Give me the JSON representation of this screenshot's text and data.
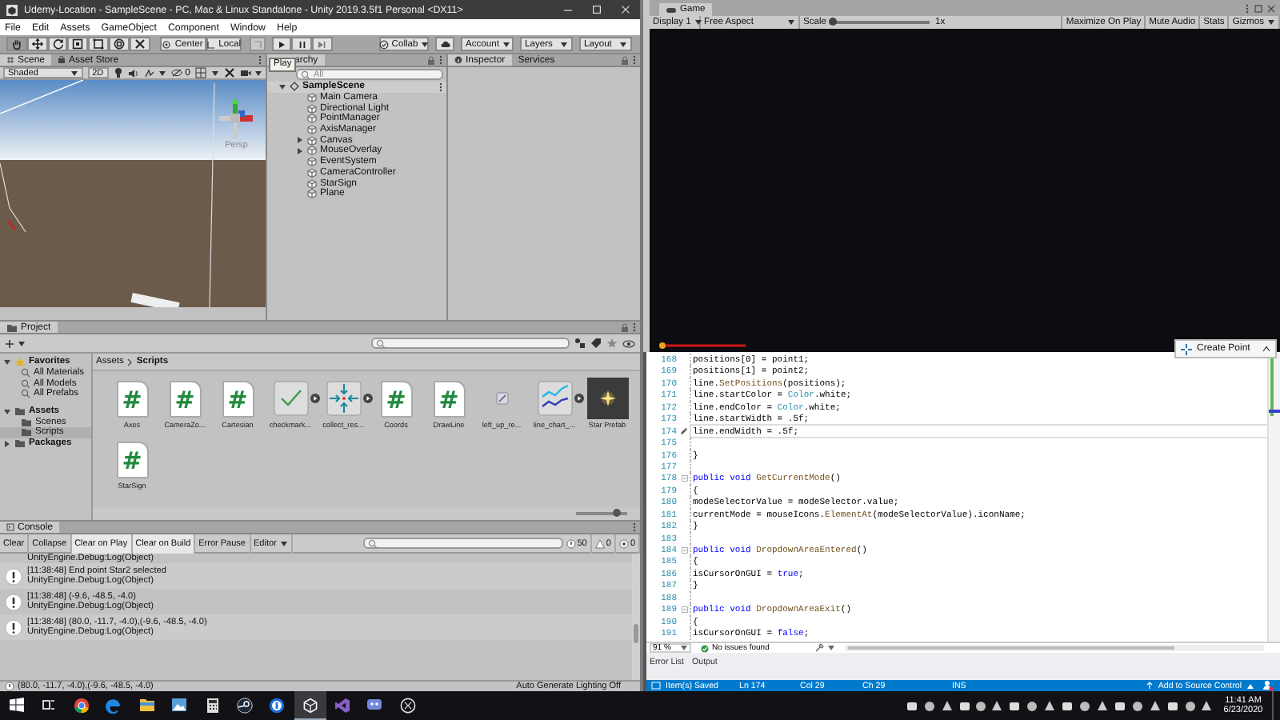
{
  "unity": {
    "title": "Udemy-Location - SampleScene - PC, Mac & Linux Standalone - Unity 2019.3.5f1 Personal <DX11>",
    "menu": [
      "File",
      "Edit",
      "Assets",
      "GameObject",
      "Component",
      "Window",
      "Help"
    ],
    "toolbar": {
      "tools": [
        {
          "kind": "hand",
          "selected": true
        },
        {
          "kind": "move",
          "selected": false
        },
        {
          "kind": "rotate",
          "selected": false
        },
        {
          "kind": "scale",
          "selected": false
        },
        {
          "kind": "rect",
          "selected": false
        },
        {
          "kind": "transform",
          "selected": false
        },
        {
          "kind": "custom",
          "selected": false
        }
      ],
      "pivot_buttons": [
        "Center",
        "Local"
      ],
      "collab": "Collab",
      "dropdowns": [
        "Account",
        "Layers",
        "Layout"
      ],
      "tooltip": "Play"
    },
    "scene": {
      "tabs": [
        {
          "label": "Scene",
          "selected": true
        },
        {
          "label": "Asset Store",
          "selected": false
        }
      ],
      "shading": "Shaded",
      "mode_2d": "2D",
      "hidden_count": "0",
      "view_label": "Persp"
    },
    "hierarchy": {
      "tab": "archy",
      "search_placeholder": "All",
      "scene": "SampleScene",
      "items": [
        {
          "label": "Main Camera",
          "has_children": false
        },
        {
          "label": "Directional Light",
          "has_children": false
        },
        {
          "label": "PointManager",
          "has_children": false
        },
        {
          "label": "AxisManager",
          "has_children": false
        },
        {
          "label": "Canvas",
          "has_children": true
        },
        {
          "label": "MouseOverlay",
          "has_children": true
        },
        {
          "label": "EventSystem",
          "has_children": false
        },
        {
          "label": "CameraController",
          "has_children": false
        },
        {
          "label": "StarSign",
          "has_children": false
        },
        {
          "label": "Plane",
          "has_children": false
        }
      ]
    },
    "inspector": {
      "tabs": [
        {
          "label": "Inspector",
          "selected": true
        },
        {
          "label": "Services",
          "selected": false
        }
      ]
    },
    "project": {
      "tab": "Project",
      "tree": [
        {
          "label": "Favorites",
          "kind": "favorites",
          "expanded": true,
          "selected": false,
          "children": [
            {
              "label": "All Materials",
              "kind": "search",
              "selected": false
            },
            {
              "label": "All Models",
              "kind": "search",
              "selected": false
            },
            {
              "label": "All Prefabs",
              "kind": "search",
              "selected": false
            }
          ]
        },
        {
          "label": "Assets",
          "kind": "folder",
          "expanded": true,
          "selected": false,
          "children": [
            {
              "label": "Scenes",
              "kind": "folder",
              "selected": false
            },
            {
              "label": "Scripts",
              "kind": "folder",
              "selected": true
            }
          ]
        },
        {
          "label": "Packages",
          "kind": "folder",
          "expanded": false,
          "selected": false
        }
      ],
      "breadcrumb": [
        "Assets",
        "Scripts"
      ],
      "assets": [
        {
          "label": "Axes",
          "kind": "script",
          "glyph": "#",
          "expandable": false
        },
        {
          "label": "CameraZo...",
          "kind": "script",
          "glyph": "#",
          "expandable": false
        },
        {
          "label": "Cartesian",
          "kind": "script",
          "glyph": "#",
          "expandable": false
        },
        {
          "label": "checkmark...",
          "kind": "checkmark",
          "expandable": true
        },
        {
          "label": "collect_res...",
          "kind": "collect",
          "expandable": true
        },
        {
          "label": "Coords",
          "kind": "script",
          "glyph": "#",
          "expandable": false
        },
        {
          "label": "DrawLine",
          "kind": "script",
          "glyph": "#",
          "expandable": false
        },
        {
          "label": "left_up_re...",
          "kind": "link",
          "expandable": false
        },
        {
          "label": "line_chart_...",
          "kind": "line_chart",
          "expandable": true
        },
        {
          "label": "Star Prefab",
          "kind": "prefab",
          "expandable": false
        },
        {
          "label": "StarSign",
          "kind": "script",
          "glyph": "#",
          "expandable": false
        }
      ],
      "icon_size": {
        "level": 0.8
      }
    },
    "console": {
      "tab": "Console",
      "buttons": [
        {
          "label": "Clear",
          "on": false
        },
        {
          "label": "Collapse",
          "on": false
        },
        {
          "label": "Clear on Play",
          "on": true
        },
        {
          "label": "Clear on Build",
          "on": true
        },
        {
          "label": "Error Pause",
          "on": false
        }
      ],
      "editor_dropdown": "Editor",
      "counts": [
        {
          "kind": "log",
          "count": "50"
        },
        {
          "kind": "warning",
          "count": "0"
        },
        {
          "kind": "error",
          "count": "0"
        }
      ],
      "entries": [
        {
          "trace": "UnityEngine.Debug:Log(Object)"
        },
        {
          "message": "[11:38:48] End point Star2 selected",
          "trace": "UnityEngine.Debug:Log(Object)"
        },
        {
          "message": "[11:38:48] (-9.6, -48.5, -4.0)",
          "trace": "UnityEngine.Debug:Log(Object)"
        },
        {
          "message": "[11:38:48] (80.0, -11.7, -4.0),(-9.6, -48.5, -4.0)",
          "trace": "UnityEngine.Debug:Log(Object)"
        }
      ]
    },
    "status_bar": {
      "message": "(80.0, -11.7, -4.0),(-9.6, -48.5, -4.0)",
      "lighting": "Auto Generate Lighting Off"
    }
  },
  "game": {
    "tab": "Game",
    "display": "Display 1",
    "aspect": "Free Aspect",
    "scale_label": "Scale",
    "scale": {
      "level": 0
    },
    "scale_value": "1x",
    "buttons": [
      "Maximize On Play",
      "Mute Audio",
      "Stats",
      "Gizmos"
    ],
    "create_point": "Create Point"
  },
  "editor": {
    "lines": [
      {
        "number": "168",
        "current": false,
        "foldable": false,
        "segments": [
          {
            "text": "        positions[0] = point1;",
            "kind": "plain"
          }
        ]
      },
      {
        "number": "169",
        "current": false,
        "foldable": false,
        "segments": [
          {
            "text": "        positions[1] = point2;",
            "kind": "plain"
          }
        ]
      },
      {
        "number": "170",
        "current": false,
        "foldable": false,
        "segments": [
          {
            "text": "        line.",
            "kind": "plain"
          },
          {
            "text": "SetPositions",
            "kind": "method"
          },
          {
            "text": "(positions);",
            "kind": "plain"
          }
        ]
      },
      {
        "number": "171",
        "current": false,
        "foldable": false,
        "segments": [
          {
            "text": "        line.startColor = ",
            "kind": "plain"
          },
          {
            "text": "Color",
            "kind": "type"
          },
          {
            "text": ".white;",
            "kind": "plain"
          }
        ]
      },
      {
        "number": "172",
        "current": false,
        "foldable": false,
        "segments": [
          {
            "text": "        line.endColor = ",
            "kind": "plain"
          },
          {
            "text": "Color",
            "kind": "type"
          },
          {
            "text": ".white;",
            "kind": "plain"
          }
        ]
      },
      {
        "number": "173",
        "current": false,
        "foldable": false,
        "segments": [
          {
            "text": "        line.startWidth = .5f;",
            "kind": "plain"
          }
        ]
      },
      {
        "number": "174",
        "current": true,
        "foldable": false,
        "segments": [
          {
            "text": "        line.endWidth = .5f;",
            "kind": "plain"
          }
        ]
      },
      {
        "number": "175",
        "current": false,
        "foldable": false
      },
      {
        "number": "176",
        "current": false,
        "foldable": false,
        "segments": [
          {
            "text": "    }",
            "kind": "plain"
          }
        ]
      },
      {
        "number": "177",
        "current": false,
        "foldable": false
      },
      {
        "number": "178",
        "current": false,
        "foldable": true,
        "segments": [
          {
            "text": "    public void ",
            "kind": "keyword"
          },
          {
            "text": "GetCurrentMode",
            "kind": "method"
          },
          {
            "text": "()",
            "kind": "plain"
          }
        ]
      },
      {
        "number": "179",
        "current": false,
        "foldable": false,
        "segments": [
          {
            "text": "    {",
            "kind": "plain"
          }
        ]
      },
      {
        "number": "180",
        "current": false,
        "foldable": false,
        "segments": [
          {
            "text": "        modeSelectorValue = modeSelector.value;",
            "kind": "plain"
          }
        ]
      },
      {
        "number": "181",
        "current": false,
        "foldable": false,
        "segments": [
          {
            "text": "        currentMode = mouseIcons.",
            "kind": "plain"
          },
          {
            "text": "ElementAt",
            "kind": "method"
          },
          {
            "text": "(modeSelectorValue).iconName;",
            "kind": "plain"
          }
        ]
      },
      {
        "number": "182",
        "current": false,
        "foldable": false,
        "segments": [
          {
            "text": "    }",
            "kind": "plain"
          }
        ]
      },
      {
        "number": "183",
        "current": false,
        "foldable": false
      },
      {
        "number": "184",
        "current": false,
        "foldable": true,
        "segments": [
          {
            "text": "    public void ",
            "kind": "keyword"
          },
          {
            "text": "DropdownAreaEntered",
            "kind": "method"
          },
          {
            "text": "()",
            "kind": "plain"
          }
        ]
      },
      {
        "number": "185",
        "current": false,
        "foldable": false,
        "segments": [
          {
            "text": "    {",
            "kind": "plain"
          }
        ]
      },
      {
        "number": "186",
        "current": false,
        "foldable": false,
        "segments": [
          {
            "text": "        isCursorOnGUI = ",
            "kind": "plain"
          },
          {
            "text": "true",
            "kind": "keyword"
          },
          {
            "text": ";",
            "kind": "plain"
          }
        ]
      },
      {
        "number": "187",
        "current": false,
        "foldable": false,
        "segments": [
          {
            "text": "    }",
            "kind": "plain"
          }
        ]
      },
      {
        "number": "188",
        "current": false,
        "foldable": false
      },
      {
        "number": "189",
        "current": false,
        "foldable": true,
        "segments": [
          {
            "text": "    public void ",
            "kind": "keyword"
          },
          {
            "text": "DropdownAreaExit",
            "kind": "method"
          },
          {
            "text": "()",
            "kind": "plain"
          }
        ]
      },
      {
        "number": "190",
        "current": false,
        "foldable": false,
        "segments": [
          {
            "text": "    {",
            "kind": "plain"
          }
        ]
      },
      {
        "number": "191",
        "current": false,
        "foldable": false,
        "segments": [
          {
            "text": "        isCursorOnGUI = ",
            "kind": "plain"
          },
          {
            "text": "false",
            "kind": "keyword"
          },
          {
            "text": ";",
            "kind": "plain"
          }
        ]
      }
    ],
    "zoom": "91 %",
    "issues": "No issues found",
    "panel_tabs": [
      "Error List",
      "Output"
    ],
    "status": [
      "Item(s) Saved",
      "Ln 174",
      "Col 29",
      "Ch 29",
      "INS"
    ],
    "source_control": "Add to Source Control"
  },
  "taskbar": {
    "apps": [
      {
        "kind": "start",
        "active": false
      },
      {
        "kind": "taskview",
        "active": false
      },
      {
        "kind": "chrome",
        "active": false
      },
      {
        "kind": "edge",
        "active": false
      },
      {
        "kind": "explorer",
        "active": false
      },
      {
        "kind": "photos",
        "active": false
      },
      {
        "kind": "calculator",
        "active": false
      },
      {
        "kind": "steam",
        "active": false
      },
      {
        "kind": "password",
        "active": false
      },
      {
        "kind": "unity",
        "active": true
      },
      {
        "kind": "vs",
        "active": false
      },
      {
        "kind": "discord",
        "active": false
      },
      {
        "kind": "circle",
        "active": false
      }
    ],
    "time": "11:41 AM",
    "date": "6/23/2020"
  }
}
